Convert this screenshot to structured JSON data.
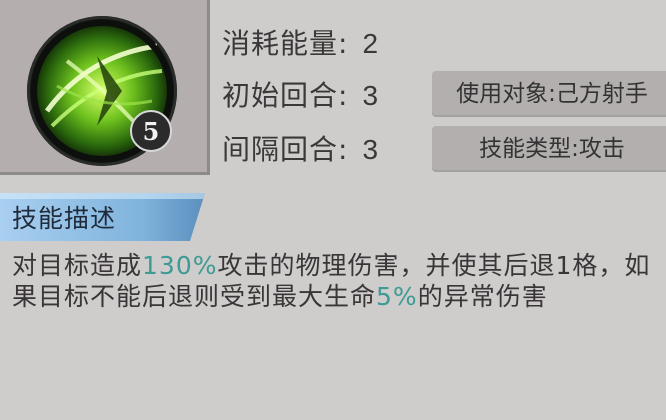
{
  "skill": {
    "level": "5",
    "icon": "green-slash-skill-icon",
    "stats": [
      {
        "label": "消耗能量:",
        "value": "2"
      },
      {
        "label": "初始回合:",
        "value": "3"
      },
      {
        "label": "间隔回合:",
        "value": "3"
      }
    ],
    "target_tag": "使用对象:己方射手",
    "type_tag": "技能类型:攻击"
  },
  "description_section": {
    "title": "技能描述",
    "segments": [
      {
        "text": "对目标造成",
        "highlight": false
      },
      {
        "text": "130%",
        "highlight": true
      },
      {
        "text": "攻击的物理伤害，并使其后退1格，如果目标不能后退则受到最大生命",
        "highlight": false
      },
      {
        "text": "5%",
        "highlight": true
      },
      {
        "text": "的异常伤害",
        "highlight": false
      }
    ]
  },
  "colors": {
    "highlight": "#3d9b94",
    "background": "#cfcccc",
    "header_blue": "#7fb3dc"
  }
}
